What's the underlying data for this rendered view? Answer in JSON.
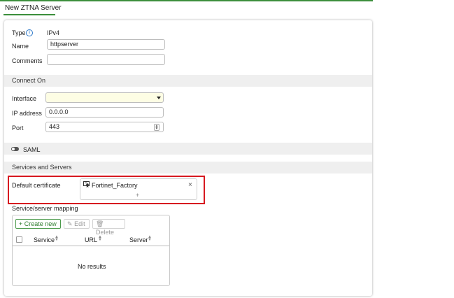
{
  "page": {
    "title": "New ZTNA Server"
  },
  "form": {
    "type_label": "Type",
    "type_value": "IPv4",
    "name_label": "Name",
    "name_value": "httpserver",
    "comments_label": "Comments",
    "comments_value": ""
  },
  "connect_on": {
    "heading": "Connect On",
    "interface_label": "Interface",
    "interface_value": "",
    "ip_label": "IP address",
    "ip_value": "0.0.0.0",
    "port_label": "Port",
    "port_value": "443"
  },
  "saml": {
    "label": "SAML",
    "enabled": false
  },
  "services": {
    "heading": "Services and Servers",
    "default_cert_label": "Default certificate",
    "certificate": "Fortinet_Factory",
    "add_symbol": "+",
    "remove_symbol": "×",
    "mapping_label": "Service/server mapping"
  },
  "toolbar": {
    "create_label": "Create new",
    "create_icon": "+",
    "edit_label": "Edit",
    "delete_label": "Delete"
  },
  "table": {
    "columns": [
      "Service",
      "URL",
      "Server"
    ],
    "empty_text": "No results"
  },
  "colors": {
    "accent": "#3c8f3c",
    "highlight": "#d71920",
    "info": "#2c78c9"
  }
}
